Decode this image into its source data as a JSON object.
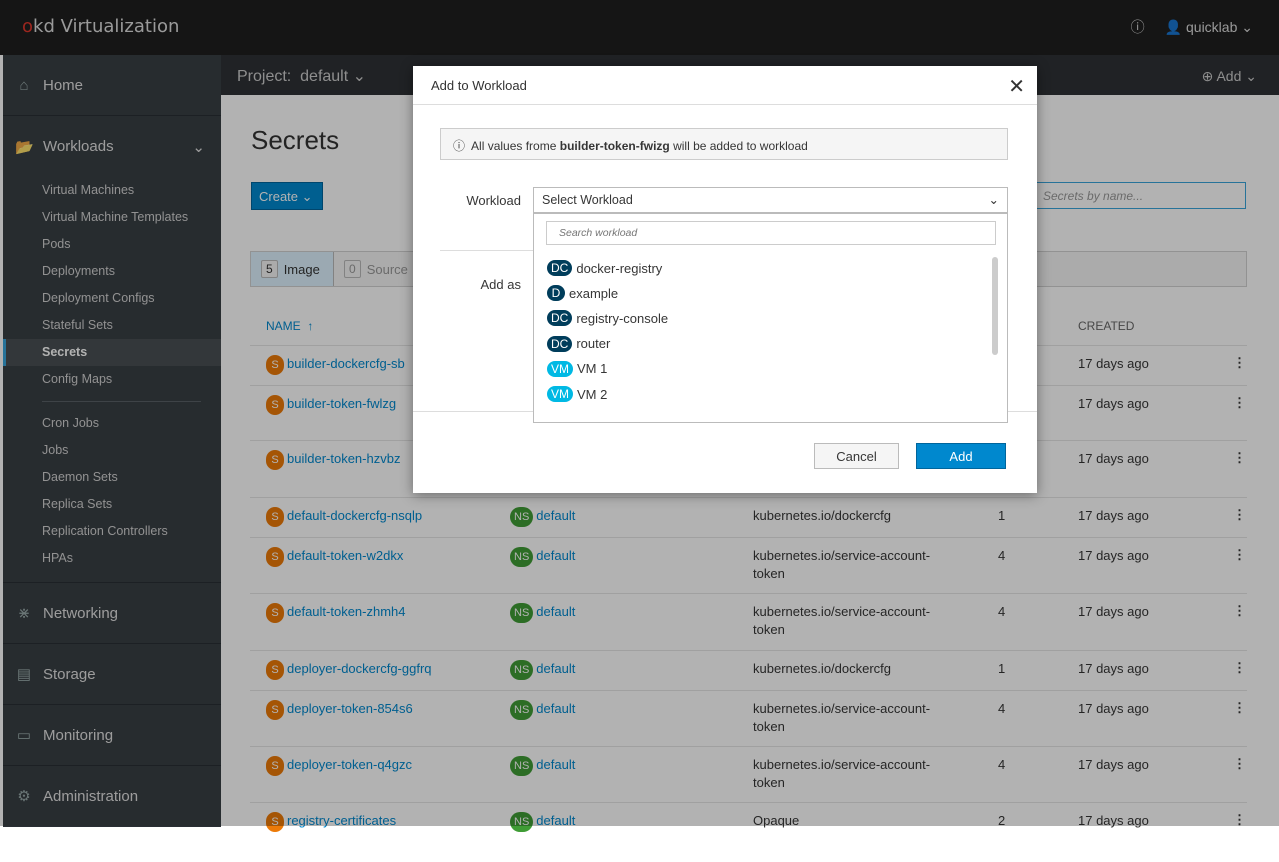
{
  "app": {
    "logo_prefix": "okd",
    "title": "Virtualization",
    "help_icon": "question-circle-icon",
    "user": "quicklab"
  },
  "sidebar": {
    "sections": [
      {
        "label": "Home",
        "icon": "home-icon"
      },
      {
        "label": "Workloads",
        "icon": "folder-open-icon",
        "expanded": true,
        "items": [
          "Virtual Machines",
          "Virtual Machine Templates",
          "Pods",
          "Deployments",
          "Deployment Configs",
          "Stateful Sets",
          "Secrets",
          "Config Maps",
          "Cron Jobs",
          "Jobs",
          "Daemon Sets",
          "Replica Sets",
          "Replication Controllers",
          "HPAs"
        ],
        "active": "Secrets"
      },
      {
        "label": "Networking",
        "icon": "network-icon"
      },
      {
        "label": "Storage",
        "icon": "storage-icon"
      },
      {
        "label": "Monitoring",
        "icon": "monitor-icon"
      },
      {
        "label": "Administration",
        "icon": "gear-icon"
      }
    ]
  },
  "project": {
    "label": "Project:",
    "value": "default",
    "add": "Add"
  },
  "page": {
    "title": "Secrets",
    "create": "Create",
    "filter_placeholder": "Secrets by name...",
    "row_filters": [
      {
        "count": "5",
        "label": "Image"
      },
      {
        "count": "0",
        "label": "Source"
      }
    ],
    "headers": {
      "name": "NAME",
      "created": "CREATED"
    },
    "rows": [
      {
        "name": "builder-dockercfg-sb",
        "created": "17 days ago"
      },
      {
        "name": "builder-token-fwlzg",
        "created": "17 days ago"
      },
      {
        "name": "builder-token-hzvbz",
        "created": "17 days ago"
      },
      {
        "name": "default-dockercfg-nsqlp",
        "ns": "default",
        "type": "kubernetes.io/dockercfg",
        "size": "1",
        "created": "17 days ago"
      },
      {
        "name": "default-token-w2dkx",
        "ns": "default",
        "type": "kubernetes.io/service-account-token",
        "size": "4",
        "created": "17 days ago"
      },
      {
        "name": "default-token-zhmh4",
        "ns": "default",
        "type": "kubernetes.io/service-account-token",
        "size": "4",
        "created": "17 days ago"
      },
      {
        "name": "deployer-dockercfg-ggfrq",
        "ns": "default",
        "type": "kubernetes.io/dockercfg",
        "size": "1",
        "created": "17 days ago"
      },
      {
        "name": "deployer-token-854s6",
        "ns": "default",
        "type": "kubernetes.io/service-account-token",
        "size": "4",
        "created": "17 days ago"
      },
      {
        "name": "deployer-token-q4gzc",
        "ns": "default",
        "type": "kubernetes.io/service-account-token",
        "size": "4",
        "created": "17 days ago"
      },
      {
        "name": "registry-certificates",
        "ns": "default",
        "type": "Opaque",
        "size": "2",
        "created": "17 days ago"
      }
    ]
  },
  "modal": {
    "title": "Add to Workload",
    "info_pre": "All values frome ",
    "info_bold": "builder-token-fwizg",
    "info_post": " will be added to workload",
    "workload_label": "Workload",
    "select_value": "Select Workload",
    "search_placeholder": "Search workload",
    "add_as_label": "Add as",
    "options": [
      {
        "badge": "DC",
        "label": "docker-registry"
      },
      {
        "badge": "D",
        "label": "example"
      },
      {
        "badge": "DC",
        "label": "registry-console"
      },
      {
        "badge": "DC",
        "label": "router"
      },
      {
        "badge": "VM",
        "label": "VM 1"
      },
      {
        "badge": "VM",
        "label": "VM 2"
      }
    ],
    "cancel": "Cancel",
    "add": "Add"
  },
  "colors": {
    "accent": "#0088ce",
    "secret_badge": "#ec7a08",
    "ns_badge": "#3f9c35",
    "dc_badge": "#003d5b",
    "vm_badge": "#00b9e4"
  }
}
